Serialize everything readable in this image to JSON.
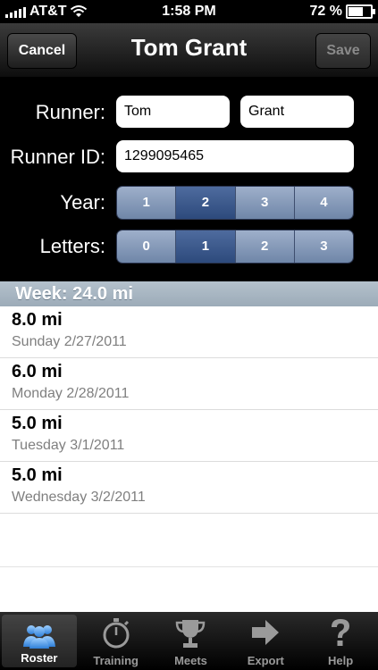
{
  "status_bar": {
    "carrier": "AT&T",
    "time": "1:58 PM",
    "battery_percent": "72 %",
    "battery_level": 0.72
  },
  "nav": {
    "cancel_label": "Cancel",
    "title": "Tom Grant",
    "save_label": "Save"
  },
  "form": {
    "runner_label": "Runner:",
    "first_name": "Tom",
    "last_name": "Grant",
    "runner_id_label": "Runner ID:",
    "runner_id": "1299095465",
    "year_label": "Year:",
    "year_options": [
      "1",
      "2",
      "3",
      "4"
    ],
    "year_selected": "2",
    "letters_label": "Letters:",
    "letters_options": [
      "0",
      "1",
      "2",
      "3"
    ],
    "letters_selected": "1"
  },
  "week": {
    "header": "Week: 24.0 mi"
  },
  "runs": [
    {
      "distance": "8.0 mi",
      "date": "Sunday 2/27/2011"
    },
    {
      "distance": "6.0 mi",
      "date": "Monday 2/28/2011"
    },
    {
      "distance": "5.0 mi",
      "date": "Tuesday 3/1/2011"
    },
    {
      "distance": "5.0 mi",
      "date": "Wednesday 3/2/2011"
    }
  ],
  "tabs": [
    {
      "label": "Roster",
      "icon": "roster-icon",
      "active": true
    },
    {
      "label": "Training",
      "icon": "stopwatch-icon",
      "active": false
    },
    {
      "label": "Meets",
      "icon": "trophy-icon",
      "active": false
    },
    {
      "label": "Export",
      "icon": "export-arrow-icon",
      "active": false
    },
    {
      "label": "Help",
      "icon": "question-icon",
      "active": false
    }
  ],
  "colors": {
    "segment_selected": "#2d4a7c",
    "segment": "#8a9dba",
    "section_header": "#a9b7c3"
  }
}
